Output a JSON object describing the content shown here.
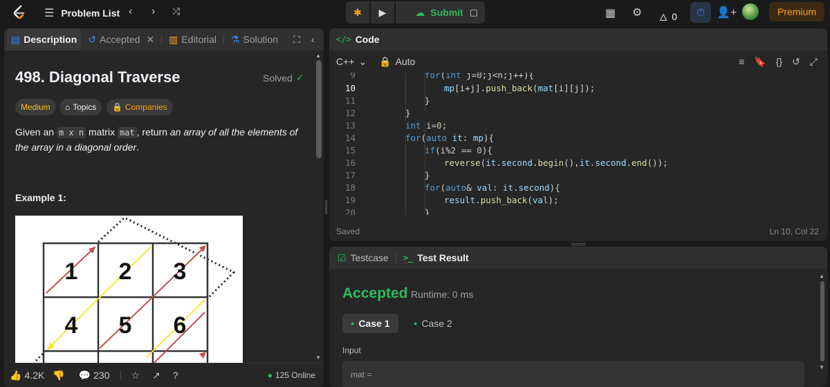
{
  "topbar": {
    "problem_list": "Problem List",
    "submit_label": "Submit",
    "streak": "0",
    "premium": "Premium"
  },
  "tabs": {
    "description": "Description",
    "accepted": "Accepted",
    "editorial": "Editorial",
    "solution": "Solution"
  },
  "problem": {
    "title": "498. Diagonal Traverse",
    "status": "Solved",
    "difficulty": "Medium",
    "topics": "Topics",
    "companies": "Companies",
    "desc_1": "Given an ",
    "code_m": "m x n",
    "desc_2": " matrix ",
    "code_mat": "mat",
    "desc_3": ", return ",
    "desc_italic": "an array of all the elements of the array in a diagonal order",
    "desc_4": ".",
    "example_title": "Example 1:",
    "grid_numbers": [
      "1",
      "2",
      "3",
      "4",
      "5",
      "6"
    ]
  },
  "footer": {
    "likes": "4.2K",
    "comments": "230",
    "online": "125 Online"
  },
  "code_panel": {
    "title": "Code",
    "language": "C++",
    "mode": "Auto",
    "status": "Saved",
    "cursor": "Ln 10, Col 22",
    "line_numbers": [
      "9",
      "10",
      "11",
      "12",
      "13",
      "14",
      "15",
      "16",
      "17",
      "18",
      "19",
      "20"
    ]
  },
  "result_panel": {
    "testcase_tab": "Testcase",
    "result_tab": "Test Result",
    "verdict": "Accepted",
    "runtime": "Runtime: 0 ms",
    "case1": "Case 1",
    "case2": "Case 2",
    "input_label": "Input",
    "input_value": "mat ="
  },
  "colors": {
    "accent_green": "#2cbb5d",
    "premium_orange": "#ffa116",
    "medium_yellow": "#ffc01e"
  }
}
